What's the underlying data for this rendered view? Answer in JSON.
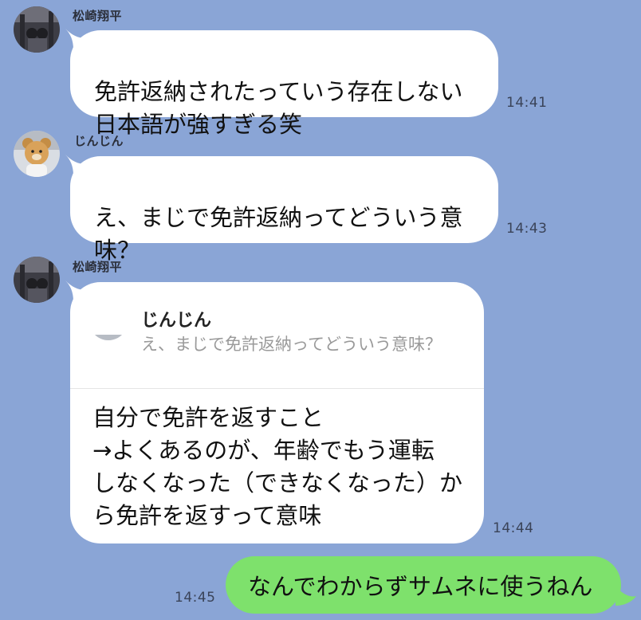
{
  "colors": {
    "background": "#8aa5d6",
    "received_bubble": "#ffffff",
    "sent_bubble": "#7ee16c"
  },
  "messages": [
    {
      "sender": "松崎翔平",
      "text": "免許返納されたっていう存在しない\n日本語が強すぎる笑",
      "time": "14:41",
      "avatar_icon": "photo-avatar-icon"
    },
    {
      "sender": "じんじん",
      "text": "え、まじで免許返納ってどういう意\n味？",
      "time": "14:43",
      "avatar_icon": "bear-avatar-icon"
    },
    {
      "sender": "松崎翔平",
      "time": "14:44",
      "avatar_icon": "photo-avatar-icon",
      "reply": {
        "quoted_sender": "じんじん",
        "quoted_text": "え、まじで免許返納ってどういう意味？",
        "body": "自分で免許を返すこと\n→よくあるのが、年齢でもう運転\nしなくなった（できなくなった）か\nら免許を返すって意味"
      }
    }
  ],
  "sent_message": {
    "text": "なんでわからずサムネに使うねん",
    "time": "14:45"
  }
}
